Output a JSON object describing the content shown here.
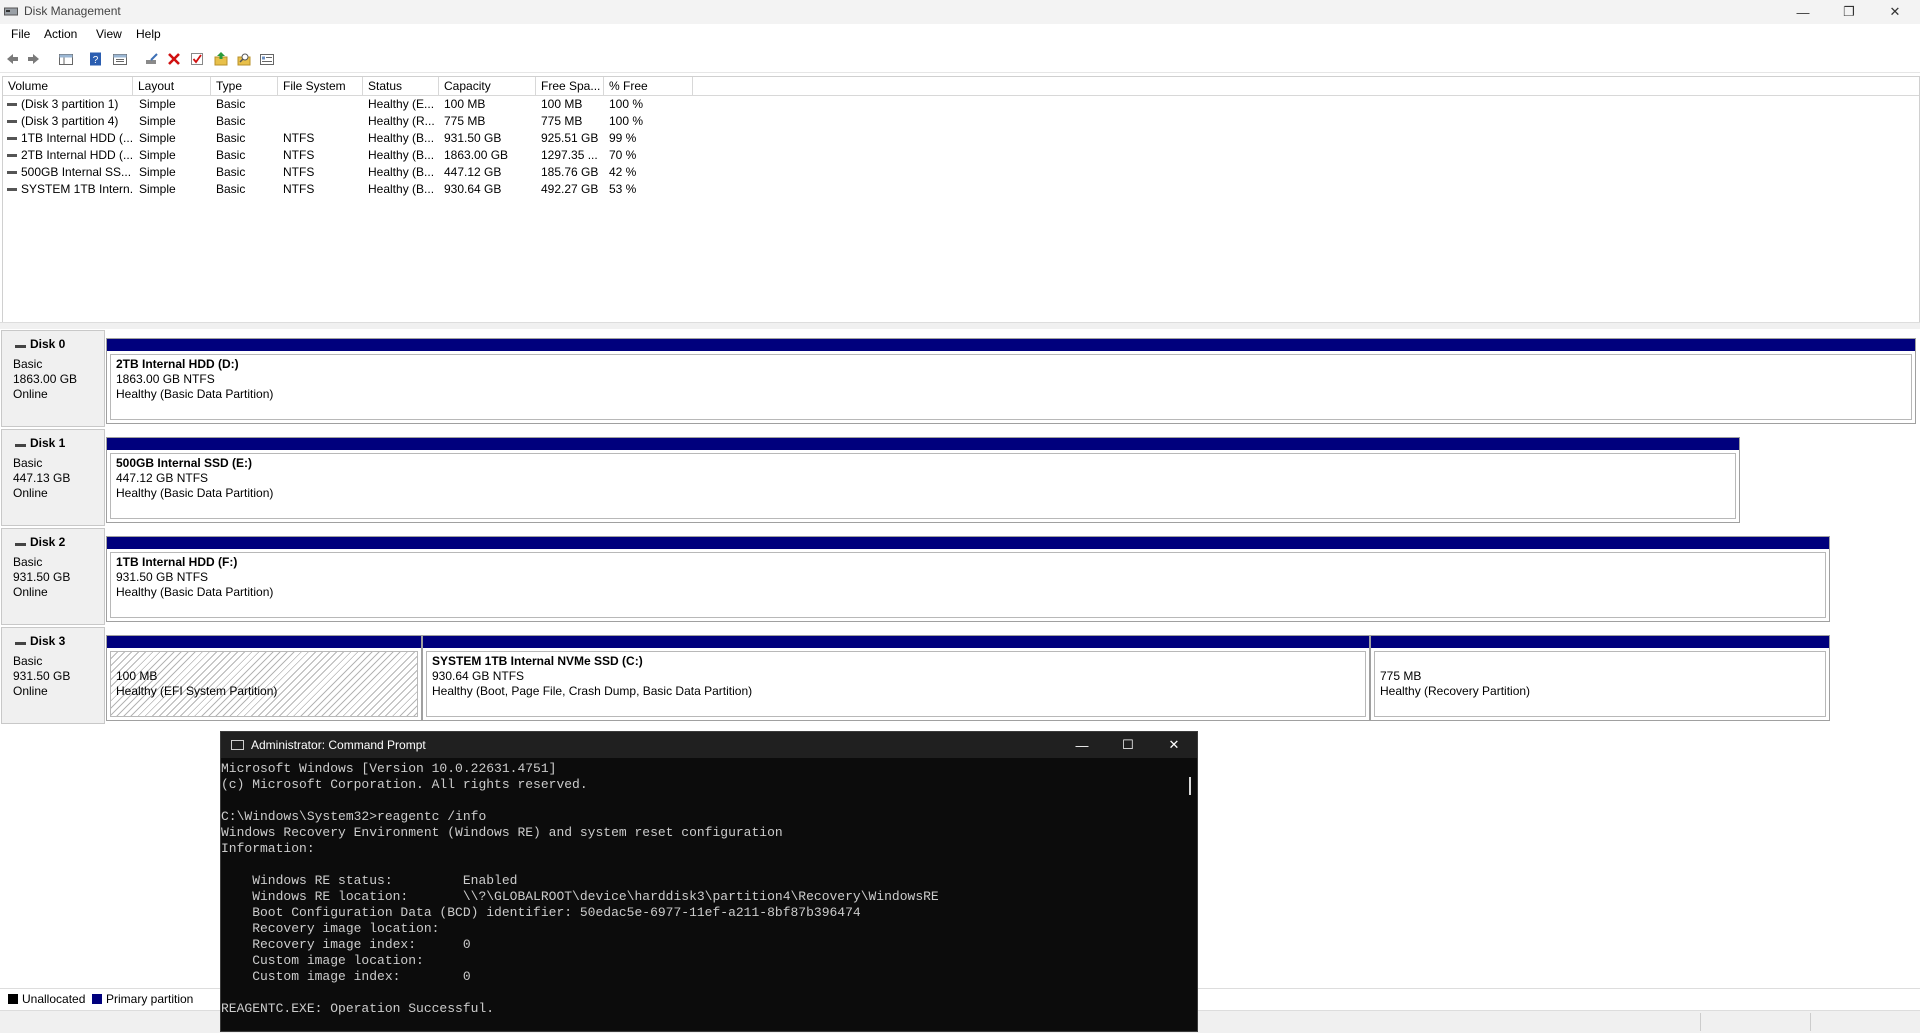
{
  "window": {
    "title": "Disk Management"
  },
  "menu": [
    "File",
    "Action",
    "View",
    "Help"
  ],
  "toolbar": {
    "buttons": [
      "back-icon",
      "forward-icon",
      "console-tree-icon",
      "help-icon",
      "properties-icon",
      "connect-icon",
      "delete-icon",
      "check-icon",
      "up-icon",
      "search-icon",
      "view-icon"
    ]
  },
  "volume_list": {
    "columns": [
      "Volume",
      "Layout",
      "Type",
      "File System",
      "Status",
      "Capacity",
      "Free Spa...",
      "% Free"
    ],
    "rows": [
      [
        "(Disk 3 partition 1)",
        "Simple",
        "Basic",
        "",
        "Healthy (E...",
        "100 MB",
        "100 MB",
        "100 %"
      ],
      [
        "(Disk 3 partition 4)",
        "Simple",
        "Basic",
        "",
        "Healthy (R...",
        "775 MB",
        "775 MB",
        "100 %"
      ],
      [
        "1TB Internal HDD (...",
        "Simple",
        "Basic",
        "NTFS",
        "Healthy (B...",
        "931.50 GB",
        "925.51 GB",
        "99 %"
      ],
      [
        "2TB Internal HDD (...",
        "Simple",
        "Basic",
        "NTFS",
        "Healthy (B...",
        "1863.00 GB",
        "1297.35 ...",
        "70 %"
      ],
      [
        "500GB Internal SS...",
        "Simple",
        "Basic",
        "NTFS",
        "Healthy (B...",
        "447.12 GB",
        "185.76 GB",
        "42 %"
      ],
      [
        "SYSTEM 1TB Intern...",
        "Simple",
        "Basic",
        "NTFS",
        "Healthy (B...",
        "930.64 GB",
        "492.27 GB",
        "53 %"
      ]
    ]
  },
  "disks": [
    {
      "name": "Disk 0",
      "type": "Basic",
      "size": "1863.00 GB",
      "state": "Online",
      "partitions": [
        {
          "title": "2TB Internal HDD  (D:)",
          "size": "1863.00 GB NTFS",
          "status": "Healthy (Basic Data Partition)"
        }
      ]
    },
    {
      "name": "Disk 1",
      "type": "Basic",
      "size": "447.13 GB",
      "state": "Online",
      "partitions": [
        {
          "title": "500GB Internal SSD  (E:)",
          "size": "447.12 GB NTFS",
          "status": "Healthy (Basic Data Partition)"
        }
      ]
    },
    {
      "name": "Disk 2",
      "type": "Basic",
      "size": "931.50 GB",
      "state": "Online",
      "partitions": [
        {
          "title": "1TB Internal HDD  (F:)",
          "size": "931.50 GB NTFS",
          "status": "Healthy (Basic Data Partition)"
        }
      ]
    },
    {
      "name": "Disk 3",
      "type": "Basic",
      "size": "931.50 GB",
      "state": "Online",
      "partitions": [
        {
          "title": "",
          "size": "100 MB",
          "status": "Healthy (EFI System Partition)"
        },
        {
          "title": "SYSTEM 1TB Internal NVMe SSD  (C:)",
          "size": "930.64 GB NTFS",
          "status": "Healthy (Boot, Page File, Crash Dump, Basic Data Partition)"
        },
        {
          "title": "",
          "size": "775 MB",
          "status": "Healthy (Recovery Partition)"
        }
      ]
    }
  ],
  "legend": {
    "unallocated": "Unallocated",
    "primary": "Primary partition",
    "unallocated_color": "#000000",
    "primary_color": "#00007d"
  },
  "cmd": {
    "title": "Administrator: Command Prompt",
    "lines": [
      "Microsoft Windows [Version 10.0.22631.4751]",
      "(c) Microsoft Corporation. All rights reserved.",
      "",
      "C:\\Windows\\System32>reagentc /info",
      "Windows Recovery Environment (Windows RE) and system reset configuration",
      "Information:",
      "",
      "    Windows RE status:         Enabled",
      "    Windows RE location:       \\\\?\\GLOBALROOT\\device\\harddisk3\\partition4\\Recovery\\WindowsRE",
      "    Boot Configuration Data (BCD) identifier: 50edac5e-6977-11ef-a211-8bf87b396474",
      "    Recovery image location:",
      "    Recovery image index:      0",
      "    Custom image location:",
      "    Custom image index:        0",
      "",
      "REAGENTC.EXE: Operation Successful."
    ]
  }
}
